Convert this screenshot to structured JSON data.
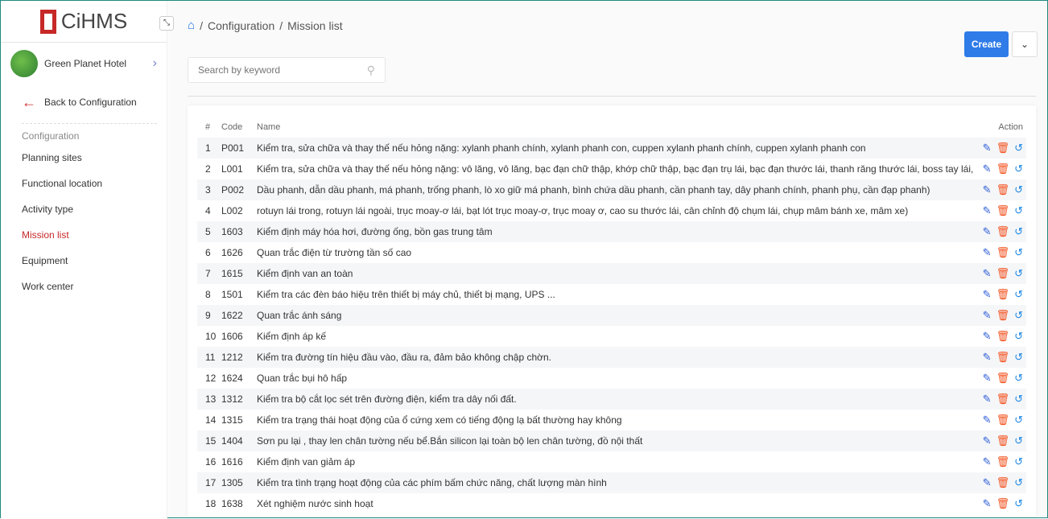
{
  "app": {
    "logo": "CiHMS",
    "hotel": "Green Planet Hotel",
    "back": "Back to Configuration"
  },
  "sidebar": {
    "group": "Configuration",
    "items": [
      {
        "label": "Planning sites"
      },
      {
        "label": "Functional location"
      },
      {
        "label": "Activity type"
      },
      {
        "label": "Mission list",
        "active": true
      },
      {
        "label": "Equipment"
      },
      {
        "label": "Work center"
      }
    ]
  },
  "breadcrumb": [
    "Configuration",
    "Mission list"
  ],
  "search": {
    "placeholder": "Search by keyword"
  },
  "toolbar": {
    "create": "Create"
  },
  "table": {
    "headers": [
      "#",
      "Code",
      "Name",
      "Action"
    ],
    "rows": [
      [
        "1",
        "P001",
        "Kiểm tra, sửa chữa và thay thế nếu hỏng nặng: xylanh phanh chính, xylanh phanh con, cuppen xylanh phanh chính, cuppen xylanh phanh con"
      ],
      [
        "2",
        "L001",
        "Kiểm tra, sửa chữa và thay thế nếu hỏng nặng: vô lăng, vô lăng, bạc đạn chữ thập, khớp chữ thập, bạc đạn trụ lái, bạc đạn thước lái, thanh răng thước lái, boss tay lái,"
      ],
      [
        "3",
        "P002",
        "Dầu phanh, dẫn dầu phanh, má phanh, trống phanh, lò xo giữ má phanh, bình chứa dầu phanh, cần phanh tay, dây phanh chính, phanh phụ, cần đạp phanh)"
      ],
      [
        "4",
        "L002",
        "rotuyn lái trong, rotuyn lái ngoài, trục moay-ơ lái, bạt lót trục moay-ơ, trục moay ơ, cao su thước lái, cân chỉnh độ chụm lái, chụp mâm bánh xe, mâm xe)"
      ],
      [
        "5",
        "1603",
        "Kiểm định máy hóa hơi, đường ống, bồn gas trung tâm"
      ],
      [
        "6",
        "1626",
        "Quan trắc điện từ trường tần số cao"
      ],
      [
        "7",
        "1615",
        "Kiểm định van an toàn"
      ],
      [
        "8",
        "1501",
        "Kiểm tra các đèn báo hiệu trên thiết bị máy chủ, thiết bị mạng, UPS ..."
      ],
      [
        "9",
        "1622",
        "Quan trắc ánh sáng"
      ],
      [
        "10",
        "1606",
        "Kiểm định áp kế"
      ],
      [
        "11",
        "1212",
        "Kiểm tra đường tín hiệu đầu vào, đầu ra, đảm bảo không chập chờn."
      ],
      [
        "12",
        "1624",
        "Quan trắc bụi hô hấp"
      ],
      [
        "13",
        "1312",
        "Kiểm tra bộ cắt lọc sét trên đường điện, kiểm tra dây nối đất."
      ],
      [
        "14",
        "1315",
        "Kiểm tra trạng thái hoạt động của ổ cứng xem có tiếng động lạ bất thường hay không"
      ],
      [
        "15",
        "1404",
        "Sơn pu lại , thay len chân tường nếu bể.Bắn silicon lại toàn bộ len chân tường, đồ nội thất"
      ],
      [
        "16",
        "1616",
        "Kiểm định van giảm áp"
      ],
      [
        "17",
        "1305",
        "Kiểm tra tình trạng hoạt động của các phím bấm chức năng, chất lượng màn hình"
      ],
      [
        "18",
        "1638",
        "Xét nghiệm nước sinh hoạt"
      ]
    ]
  }
}
